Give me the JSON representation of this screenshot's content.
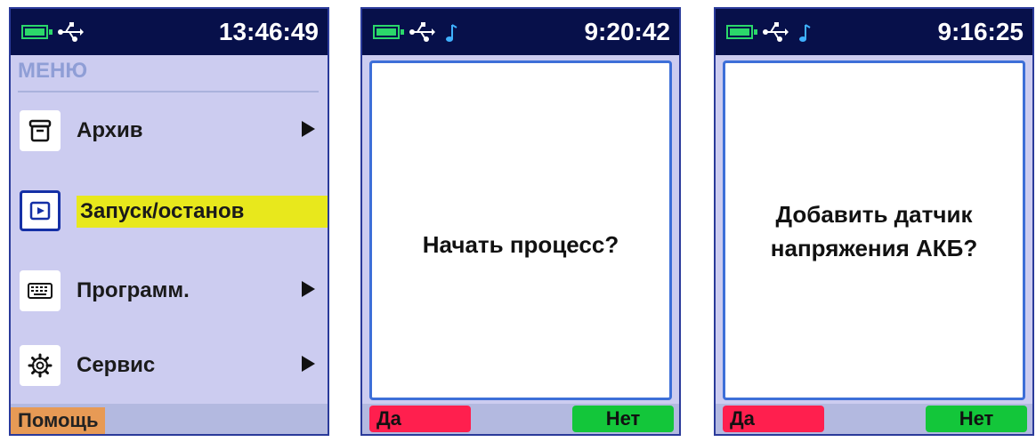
{
  "colors": {
    "status_bar": "#07104a",
    "screen_bg": "#ccccf0",
    "selection": "#e8e81c",
    "yes": "#ff1f4e",
    "no": "#13c63a",
    "help": "#e79a55",
    "dialog_border": "#3d6fd8"
  },
  "screens": [
    {
      "status": {
        "time": "13:46:49",
        "icons": [
          "battery-icon",
          "usb-icon"
        ]
      },
      "menu": {
        "title": "МЕНЮ",
        "items": [
          {
            "label": "Архив",
            "icon": "archive-icon",
            "has_submenu": true
          },
          {
            "label": "Запуск/останов",
            "icon": "play-icon",
            "selected": true
          },
          {
            "label": "Программ.",
            "icon": "keyboard-icon",
            "has_submenu": true
          },
          {
            "label": "Сервис",
            "icon": "gear-icon",
            "has_submenu": true
          }
        ]
      },
      "help_label": "Помощь"
    },
    {
      "status": {
        "time": "9:20:42",
        "icons": [
          "battery-icon",
          "usb-icon",
          "music-note-icon"
        ]
      },
      "dialog": {
        "lines": [
          "Начать процесс?"
        ]
      },
      "buttons": {
        "yes": "Да",
        "no": "Нет"
      }
    },
    {
      "status": {
        "time": "9:16:25",
        "icons": [
          "battery-icon",
          "usb-icon",
          "music-note-icon"
        ]
      },
      "dialog": {
        "lines": [
          "Добавить датчик",
          "напряжения АКБ?"
        ]
      },
      "buttons": {
        "yes": "Да",
        "no": "Нет"
      }
    }
  ]
}
